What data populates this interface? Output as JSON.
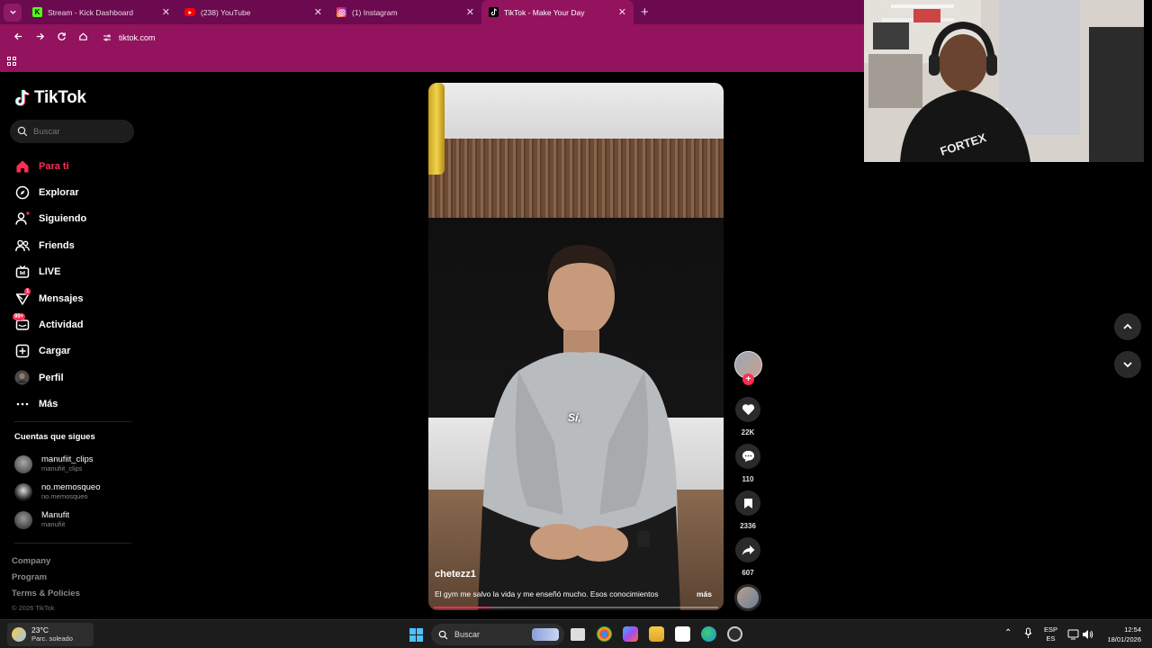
{
  "browser": {
    "tabs": [
      {
        "title": "Stream - Kick Dashboard",
        "icon": "kick-icon",
        "color": "#53fc18"
      },
      {
        "title": "(238) YouTube",
        "icon": "youtube-icon",
        "color": "#ff0000"
      },
      {
        "title": "(1) Instagram",
        "icon": "instagram-icon",
        "color": "#e1306c"
      },
      {
        "title": "TikTok - Make Your Day",
        "icon": "tiktok-icon",
        "color": "#000000"
      }
    ],
    "url": "tiktok.com",
    "chrome_color": "#93135f",
    "tabbar_color": "#6b0a4e"
  },
  "sidebar": {
    "logo": "TikTok",
    "search_placeholder": "Buscar",
    "nav": [
      {
        "label": "Para ti",
        "icon": "home-icon",
        "active": true
      },
      {
        "label": "Explorar",
        "icon": "compass-icon"
      },
      {
        "label": "Siguiendo",
        "icon": "following-icon"
      },
      {
        "label": "Friends",
        "icon": "friends-icon"
      },
      {
        "label": "LIVE",
        "icon": "live-icon"
      },
      {
        "label": "Mensajes",
        "icon": "messages-icon",
        "badge": "1"
      },
      {
        "label": "Actividad",
        "icon": "activity-icon",
        "badge": "99+"
      },
      {
        "label": "Cargar",
        "icon": "upload-icon"
      },
      {
        "label": "Perfil",
        "icon": "profile-avatar"
      },
      {
        "label": "Más",
        "icon": "more-icon"
      }
    ],
    "following_title": "Cuentas que sigues",
    "following": [
      {
        "name": "manufiit_clips",
        "handle": "manufiit_clips"
      },
      {
        "name": "no.memosqueo",
        "handle": "no.memosqueo"
      },
      {
        "name": "Manufit",
        "handle": "manufiit"
      }
    ],
    "links": [
      "Company",
      "Program",
      "Terms & Policies"
    ],
    "copyright": "© 2026 TikTok"
  },
  "video": {
    "subtitle": "Sí,",
    "username": "chetezz1",
    "description": "El gym me salvo la vida y me enseñó mucho. Esos conocimientos",
    "more": "más",
    "progress": 0.2
  },
  "actions": {
    "likes": "22K",
    "comments": "110",
    "saves": "2336",
    "shares": "607"
  },
  "taskbar": {
    "weather_temp": "23°C",
    "weather_desc": "Parc. soleado",
    "search_label": "Buscar",
    "lang_top": "ESP",
    "lang_bottom": "ES",
    "time": "12:54",
    "date": "18/01/2026"
  },
  "colors": {
    "accent": "#fe2c55"
  }
}
